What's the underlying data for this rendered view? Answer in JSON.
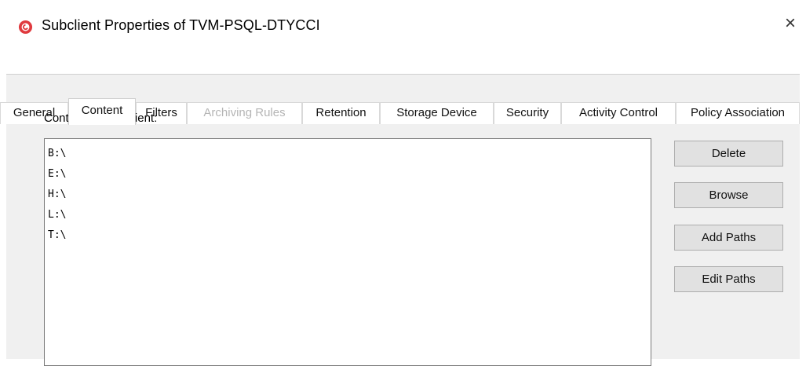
{
  "window": {
    "title": "Subclient Properties of TVM-PSQL-DTYCCI",
    "close_glyph": "×",
    "app_icon": "commvault-icon",
    "accent_color": "#e03a3e"
  },
  "tabs": [
    {
      "label": "General",
      "state": "normal"
    },
    {
      "label": "Content",
      "state": "active"
    },
    {
      "label": "Filters",
      "state": "normal"
    },
    {
      "label": "Archiving Rules",
      "state": "disabled"
    },
    {
      "label": "Retention",
      "state": "normal"
    },
    {
      "label": "Storage Device",
      "state": "normal"
    },
    {
      "label": "Security",
      "state": "normal"
    },
    {
      "label": "Activity Control",
      "state": "normal"
    },
    {
      "label": "Policy Association",
      "state": "normal"
    }
  ],
  "content": {
    "label": "Contents of subclient:",
    "items": [
      "B:\\",
      "E:\\",
      "H:\\",
      "L:\\",
      "T:\\"
    ]
  },
  "buttons": {
    "delete": "Delete",
    "browse": "Browse",
    "add_paths": "Add Paths",
    "edit_paths": "Edit Paths"
  }
}
